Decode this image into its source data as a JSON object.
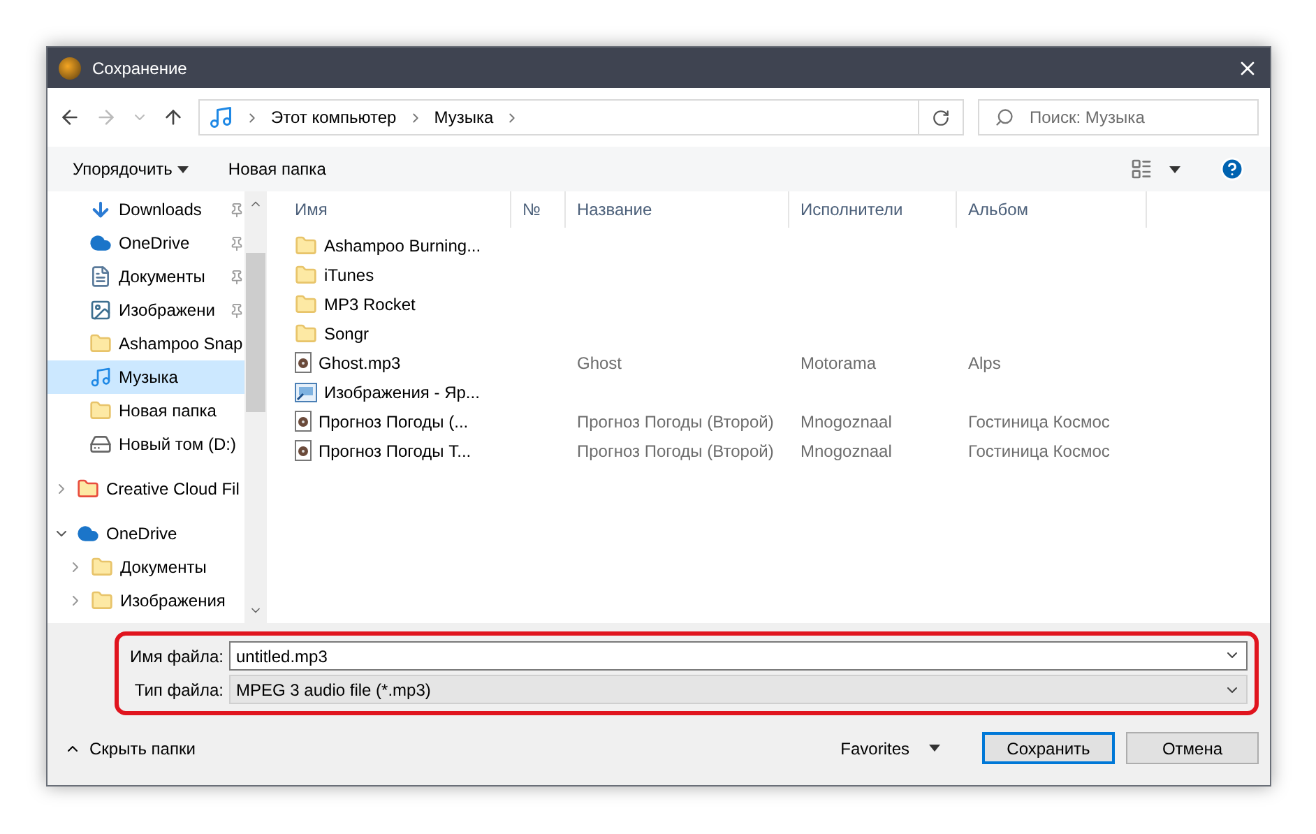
{
  "window": {
    "title": "Сохранение"
  },
  "address": {
    "crumbs": [
      "Этот компьютер",
      "Музыка"
    ],
    "search_placeholder": "Поиск: Музыка"
  },
  "toolbar": {
    "organize": "Упорядочить",
    "new_folder": "Новая папка"
  },
  "sidebar": {
    "items": [
      {
        "label": "Downloads",
        "kind": "download",
        "pinned": true,
        "selected": false
      },
      {
        "label": "OneDrive",
        "kind": "cloud",
        "pinned": true,
        "selected": false
      },
      {
        "label": "Документы",
        "kind": "document",
        "pinned": true,
        "selected": false
      },
      {
        "label": "Изображени",
        "kind": "image",
        "pinned": true,
        "selected": false
      },
      {
        "label": "Ashampoo Snap",
        "kind": "folder",
        "pinned": false,
        "selected": false
      },
      {
        "label": "Музыка",
        "kind": "music",
        "pinned": false,
        "selected": true
      },
      {
        "label": "Новая папка",
        "kind": "folder",
        "pinned": false,
        "selected": false
      },
      {
        "label": "Новый том (D:)",
        "kind": "drive",
        "pinned": false,
        "selected": false
      }
    ],
    "tree": [
      {
        "label": "Creative Cloud Fil",
        "kind": "creative",
        "expanded": false
      },
      {
        "label": "OneDrive",
        "kind": "cloud",
        "expanded": true,
        "children": [
          {
            "label": "Документы",
            "kind": "folder",
            "expanded": false
          },
          {
            "label": "Изображения",
            "kind": "folder",
            "expanded": false
          }
        ]
      }
    ]
  },
  "table": {
    "columns": [
      "Имя",
      "№",
      "Название",
      "Исполнители",
      "Альбом"
    ],
    "rows": [
      {
        "name": "Ashampoo Burning...",
        "kind": "folder"
      },
      {
        "name": "iTunes",
        "kind": "folder"
      },
      {
        "name": "MP3 Rocket",
        "kind": "folder"
      },
      {
        "name": "Songr",
        "kind": "folder"
      },
      {
        "name": "Ghost.mp3",
        "kind": "audio",
        "title": "Ghost",
        "artists": "Motorama",
        "album": "Alps"
      },
      {
        "name": "Изображения - Яр...",
        "kind": "shortcut"
      },
      {
        "name": "Прогноз Погоды (...",
        "kind": "audio",
        "title": "Прогноз Погоды (Второй)",
        "artists": "Mnogoznaal",
        "album": "Гостиница Космос"
      },
      {
        "name": "Прогноз Погоды Т...",
        "kind": "audio",
        "title": "Прогноз Погоды (Второй)",
        "artists": "Mnogoznaal",
        "album": "Гостиница Космос"
      }
    ]
  },
  "form": {
    "file_name_label": "Имя файла:",
    "file_name": "untitled.mp3",
    "file_type_label": "Тип файла:",
    "file_type": "MPEG 3 audio file (*.mp3)",
    "highlighted": true
  },
  "footer": {
    "hide_folders": "Скрыть папки",
    "favorites": "Favorites",
    "save": "Сохранить",
    "cancel": "Отмена"
  }
}
